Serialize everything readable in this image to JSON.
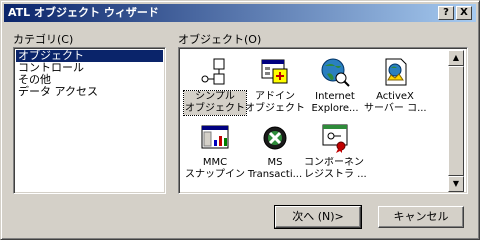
{
  "window": {
    "title": "ATL オブジェクト ウィザード",
    "help_btn": "?",
    "close_btn": "X"
  },
  "category": {
    "label": "カテゴリ(C)",
    "items": [
      "オブジェクト",
      "コントロール",
      "その他",
      "データ アクセス"
    ],
    "selected_index": 0
  },
  "objects": {
    "label": "オブジェクト(O)",
    "items": [
      {
        "line1": "シンプル",
        "line2": "オブジェクト",
        "icon": "simple-object-icon"
      },
      {
        "line1": "アドイン",
        "line2": "オブジェクト",
        "icon": "addin-object-icon"
      },
      {
        "line1": "Internet",
        "line2": "Explore...",
        "icon": "internet-explorer-icon"
      },
      {
        "line1": "ActiveX",
        "line2": "サーバー コ...",
        "icon": "activex-server-icon"
      },
      {
        "line1": "MMC",
        "line2": "スナップイン",
        "icon": "mmc-snapin-icon"
      },
      {
        "line1": "MS",
        "line2": "Transacti...",
        "icon": "ms-transaction-icon"
      },
      {
        "line1": "コンポーネント",
        "line2": "レジストラ ...",
        "icon": "component-registrar-icon"
      }
    ],
    "selected_index": 0
  },
  "buttons": {
    "next": "次へ (N)>",
    "cancel": "キャンセル"
  },
  "colors": {
    "title_start": "#0a246a",
    "title_end": "#a6caf0",
    "face": "#d4d0c8",
    "selection": "#0a246a"
  }
}
